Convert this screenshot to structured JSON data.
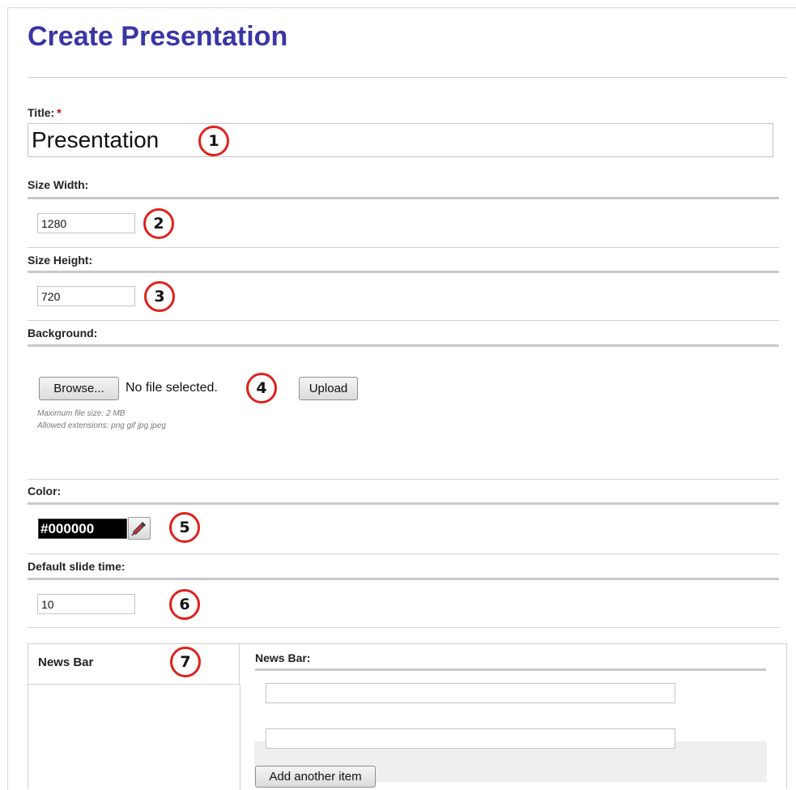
{
  "page": {
    "title": "Create Presentation"
  },
  "form": {
    "title_label": "Title:",
    "required_mark": "*",
    "title_value": "Presentation",
    "width_label": "Size Width:",
    "width_value": "1280",
    "height_label": "Size Height:",
    "height_value": "720",
    "background_label": "Background:",
    "browse_label": "Browse...",
    "file_status": "No file selected.",
    "upload_label": "Upload",
    "max_size_hint": "Maximum file size: 2 MB",
    "extensions_hint": "Allowed extensions: png gif jpg jpeg",
    "color_label": "Color:",
    "color_value": "#000000",
    "slide_time_label": "Default slide time:",
    "slide_time_value": "10"
  },
  "tabs": {
    "items": [
      {
        "label": "News Bar"
      }
    ],
    "panel": {
      "label": "News Bar:",
      "items": [
        {
          "value": ""
        },
        {
          "value": ""
        }
      ],
      "add_label": "Add another item"
    }
  },
  "markers": [
    "1",
    "2",
    "3",
    "4",
    "5",
    "6",
    "7"
  ],
  "colors": {
    "title": "#3a36a6",
    "required": "#cc0000",
    "marker_ring": "#e0201c",
    "color_swatch": "#000000"
  },
  "icons": {
    "picker": "eyedropper-icon"
  }
}
